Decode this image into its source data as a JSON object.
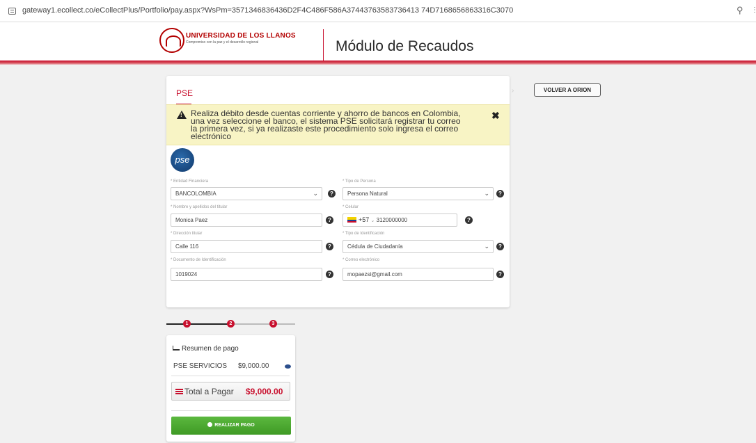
{
  "browser": {
    "url": "gateway1.ecollect.co/eCollectPlus/Portfolio/pay.aspx?WsPm=3571346836436D2F4C486F586A37443763583736413 74D7168656863316C3070"
  },
  "header": {
    "university_name": "UNIVERSIDAD DE LOS LLANOS",
    "university_motto": "Compromiso con la paz y el desarrollo regional",
    "module_title": "Módulo de Recaudos",
    "accent_color": "#c8102e"
  },
  "payment_card": {
    "tab_label": "PSE",
    "alert_text": "Realiza débito desde cuentas corriente y ahorro de bancos en Colombia, una vez seleccione el banco, el sistema PSE solicitará registrar tu correo la primera vez, si ya realizaste este procedimiento solo ingresa el correo electrónico",
    "alert_close": "✖",
    "pse_logo_text": "pse",
    "fields": {
      "bank": {
        "label": "* Entidad Financiera",
        "value": "BANCOLOMBIA"
      },
      "person_type": {
        "label": "* Tipo de Persona",
        "value": "Persona Natural"
      },
      "holder_name": {
        "label": "* Nombre y apellidos del titular",
        "value": "Monica Paez"
      },
      "phone": {
        "label": "* Celular",
        "country_code": "+57",
        "value": "3120000000"
      },
      "address": {
        "label": "* Dirección titular",
        "value": "Calle 116"
      },
      "id_type": {
        "label": "* Tipo de Identificación",
        "value": "Cédula de Ciudadanía"
      },
      "document": {
        "label": "* Documento de Identificación",
        "value": "1019024"
      },
      "email": {
        "label": "* Correo electrónico",
        "value": "mopaezsi@gmail.com"
      }
    }
  },
  "stepper": {
    "steps": [
      "1",
      "2",
      "3"
    ],
    "current_step": 3
  },
  "summary": {
    "title": "Resumen de pago",
    "item_name": "PSE SERVICIOS",
    "item_value": "$9,000.00",
    "total_label": "Total a Pagar",
    "total_value": "$9,000.00",
    "pay_button": "REALIZAR PAGO",
    "pay_color": "#4aa52f"
  },
  "back_button": "VOLVER A ORION"
}
